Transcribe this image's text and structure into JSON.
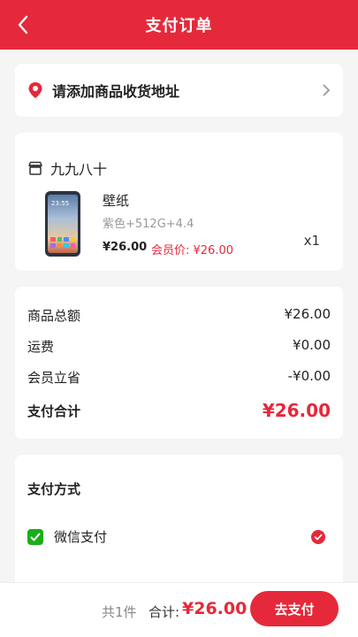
{
  "header": {
    "title": "支付订单"
  },
  "address": {
    "label": "请添加商品收货地址"
  },
  "shop": {
    "name": "九九八十",
    "product": {
      "name": "壁纸",
      "spec": "紫色+512G+4.4",
      "price": "¥26.00",
      "member_price": "会员价: ¥26.00",
      "quantity": "x1",
      "screen_time": "23:55"
    }
  },
  "summary": {
    "rows": [
      {
        "label": "商品总额",
        "value": "¥26.00"
      },
      {
        "label": "运费",
        "value": "¥0.00"
      },
      {
        "label": "会员立省",
        "value": "-¥0.00"
      }
    ],
    "total_label": "支付合计",
    "total_value": "¥26.00"
  },
  "payment": {
    "title": "支付方式",
    "option": "微信支付"
  },
  "footer": {
    "count": "共1件",
    "total_label": "合计:",
    "total_value": "¥26.00",
    "pay_button": "去支付"
  },
  "colors": {
    "accent": "#e5293a",
    "wechat": "#1aad19"
  }
}
